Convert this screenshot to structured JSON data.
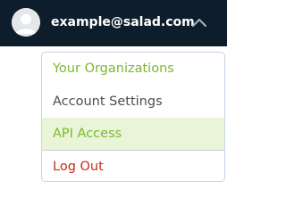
{
  "header": {
    "account_email": "example@salad.com",
    "avatar_icon": "user-avatar-icon",
    "toggle_icon": "chevron-up-icon"
  },
  "menu": {
    "items": [
      {
        "label": "Your Organizations",
        "state": "link"
      },
      {
        "label": "Account Settings",
        "state": "normal"
      },
      {
        "label": "API Access",
        "state": "selected"
      },
      {
        "label": "Log Out",
        "state": "danger"
      }
    ]
  },
  "colors": {
    "header_bg": "#0e1d2c",
    "accent_green": "#7cb82f",
    "selected_bg": "#e9f5d8",
    "danger_red": "#cc2b16",
    "text_gray": "#4a4f55"
  }
}
